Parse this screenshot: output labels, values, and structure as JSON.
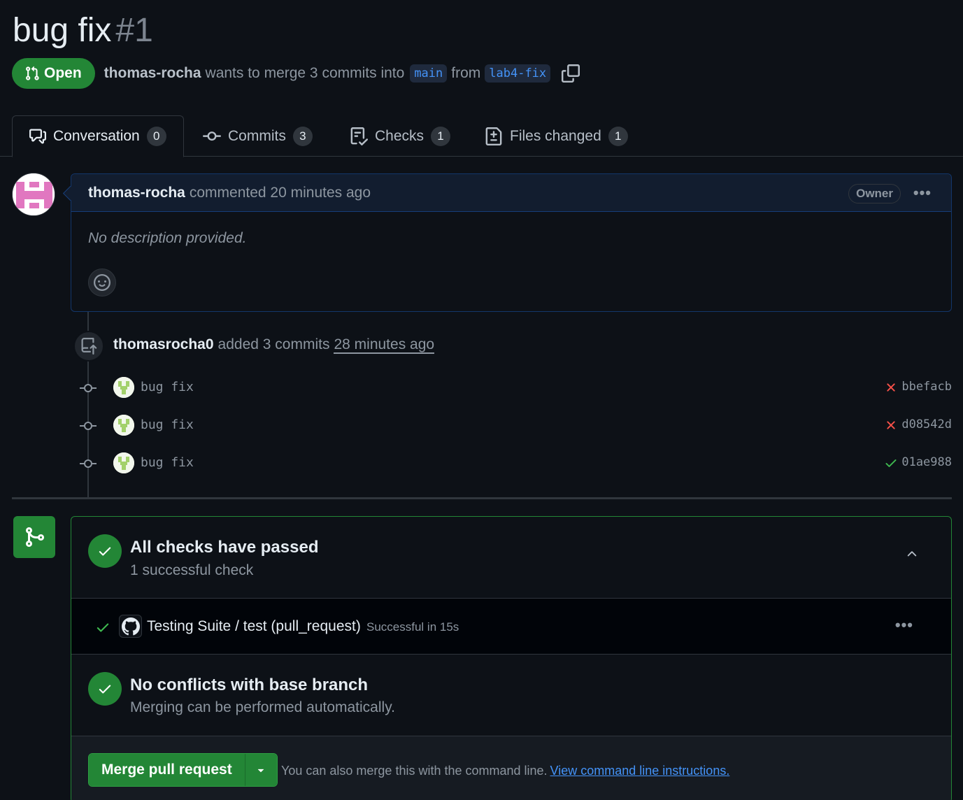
{
  "pr": {
    "title": "bug fix",
    "number": "#1",
    "state": "Open",
    "author": "thomas-rocha",
    "merge_text": "wants to merge 3 commits into",
    "base_branch": "main",
    "from_text": "from",
    "head_branch": "lab4-fix"
  },
  "tabs": [
    {
      "label": "Conversation",
      "count": "0"
    },
    {
      "label": "Commits",
      "count": "3"
    },
    {
      "label": "Checks",
      "count": "1"
    },
    {
      "label": "Files changed",
      "count": "1"
    }
  ],
  "comment": {
    "author": "thomas-rocha",
    "meta": "commented 20 minutes ago",
    "role": "Owner",
    "menu": "•••",
    "body": "No description provided."
  },
  "push": {
    "author": "thomasrocha0",
    "action": "added 3 commits",
    "time": "28 minutes ago"
  },
  "commits": [
    {
      "message": "bug fix",
      "sha": "bbefacb",
      "status": "failure"
    },
    {
      "message": "bug fix",
      "sha": "d08542d",
      "status": "failure"
    },
    {
      "message": "bug fix",
      "sha": "01ae988",
      "status": "success"
    }
  ],
  "checks": {
    "title": "All checks have passed",
    "subtitle": "1 successful check",
    "item_name": "Testing Suite / test (pull_request)",
    "item_meta": "Successful in 15s",
    "menu": "•••"
  },
  "conflicts": {
    "title": "No conflicts with base branch",
    "subtitle": "Merging can be performed automatically."
  },
  "merge": {
    "button": "Merge pull request",
    "hint": "You can also merge this with the command line.",
    "link": "View command line instructions."
  },
  "colors": {
    "success": "#238636",
    "failure": "#f85149",
    "link": "#4493f8",
    "background": "#0d1117"
  }
}
